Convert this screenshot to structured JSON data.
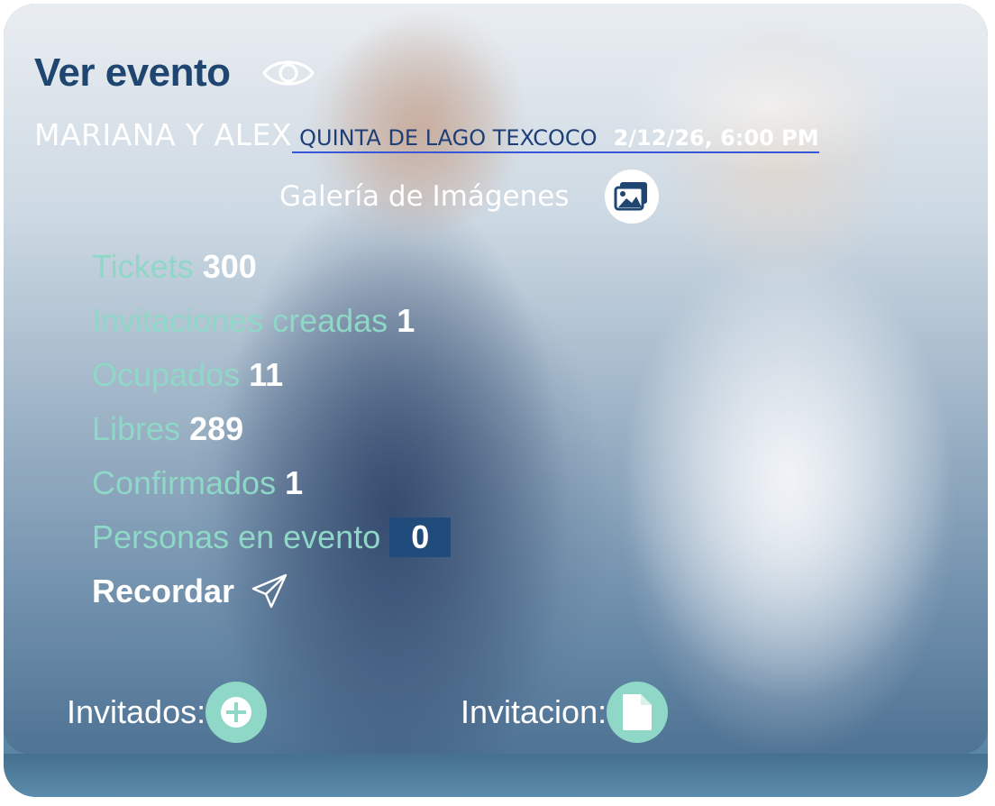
{
  "header": {
    "title": "Ver evento",
    "view_icon": "eye-icon"
  },
  "event": {
    "name": "MARIANA Y ALEX",
    "venue": "QUINTA DE LAGO TEXCOCO",
    "datetime": "2/12/26, 6:00 PM"
  },
  "gallery": {
    "label": "Galería de Imágenes",
    "icon": "image-gallery-icon"
  },
  "stats": [
    {
      "label": "Tickets",
      "value": "300"
    },
    {
      "label": "Invitaciones creadas",
      "value": "1"
    },
    {
      "label": "Ocupados",
      "value": "11"
    },
    {
      "label": "Libres",
      "value": "289"
    },
    {
      "label": "Confirmados",
      "value": "1"
    },
    {
      "label": "Personas en evento",
      "value": "0"
    }
  ],
  "remind": {
    "label": "Recordar",
    "icon": "send-icon"
  },
  "actions": {
    "guests_label": "Invitados:",
    "guests_icon": "plus-circle-icon",
    "invitation_label": "Invitacion:",
    "invitation_icon": "document-icon"
  },
  "colors": {
    "title": "#1e4670",
    "stat_label": "#8fd7c6",
    "accent_button": "#8fd7c6",
    "value_box": "#1f4c7a",
    "link_underline": "#3557d8"
  }
}
